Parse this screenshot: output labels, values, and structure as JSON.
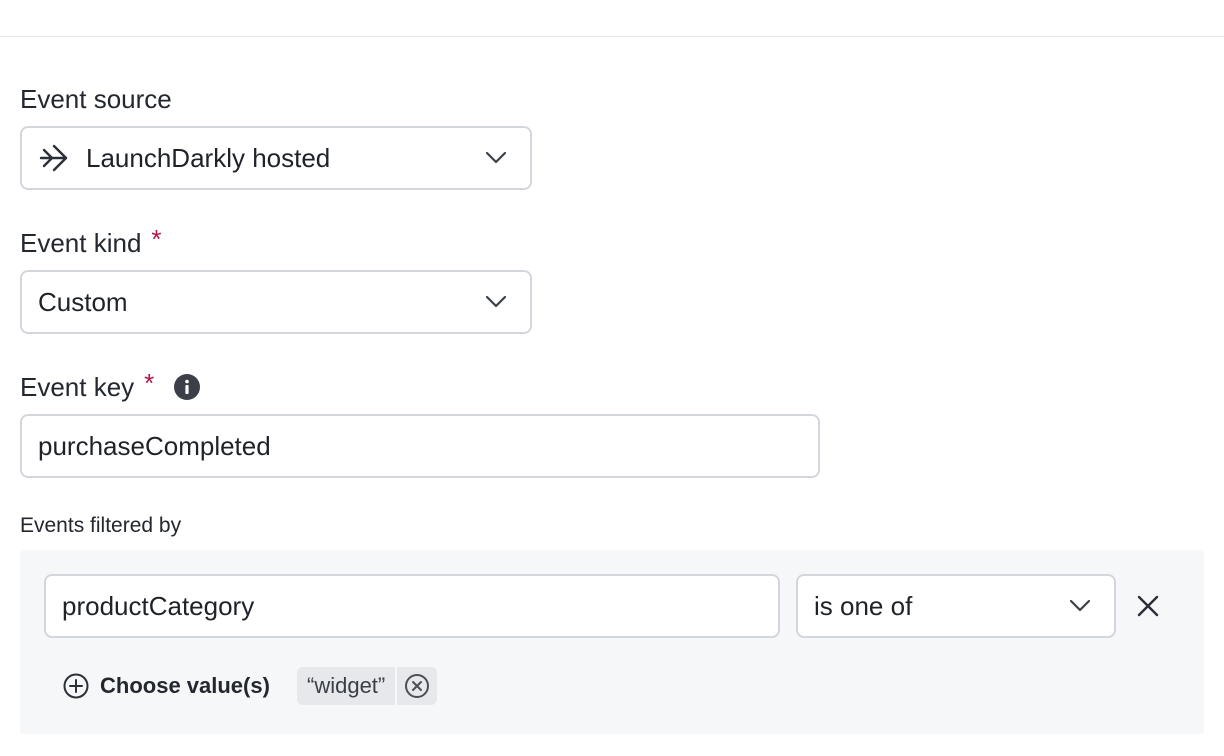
{
  "form": {
    "event_source": {
      "label": "Event source",
      "value": "LaunchDarkly hosted",
      "icon": "arrow-source-icon"
    },
    "event_kind": {
      "label": "Event kind",
      "required_mark": "*",
      "value": "Custom"
    },
    "event_key": {
      "label": "Event key",
      "required_mark": "*",
      "value": "purchaseCompleted"
    },
    "filters": {
      "label": "Events filtered by",
      "rows": [
        {
          "attribute": "productCategory",
          "operator": "is one of",
          "choose_label": "Choose value(s)",
          "values": [
            "“widget”"
          ]
        }
      ]
    }
  },
  "colors": {
    "required": "#b3124a",
    "border": "#d3d6dc",
    "panel": "#f6f7f9",
    "chip": "#e6e8ec"
  }
}
